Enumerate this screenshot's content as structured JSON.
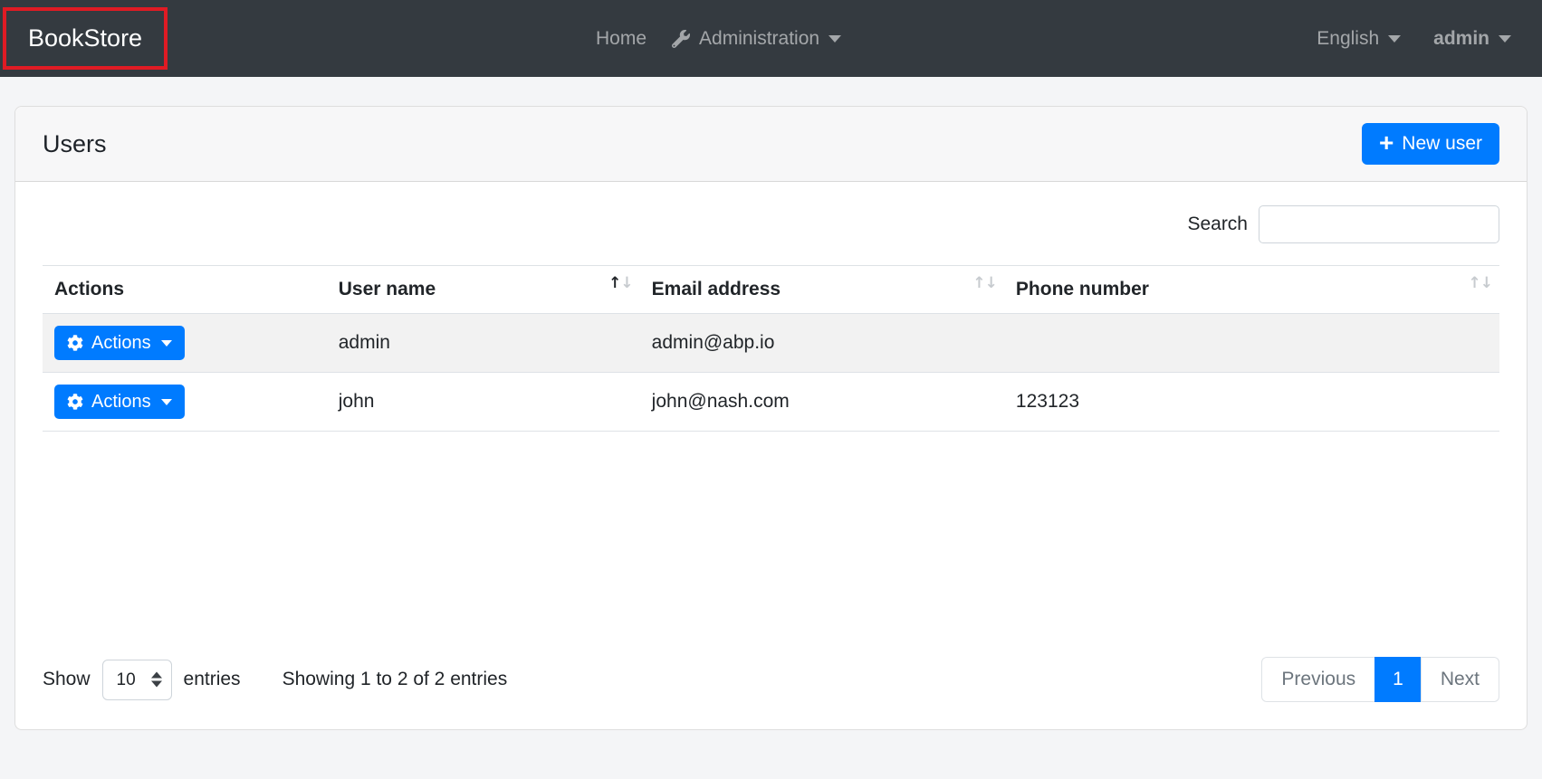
{
  "navbar": {
    "brand": "BookStore",
    "home": "Home",
    "administration": "Administration",
    "language": "English",
    "user": "admin"
  },
  "users_card": {
    "title": "Users",
    "new_user_button": "New user",
    "search_label": "Search",
    "search_value": ""
  },
  "users_table": {
    "headers": {
      "actions": "Actions",
      "user_name": "User name",
      "email": "Email address",
      "phone": "Phone number"
    },
    "sort_state": {
      "column": "User name",
      "direction": "ascending"
    },
    "rows": [
      {
        "actions": "Actions",
        "user_name": "admin",
        "email": "admin@abp.io",
        "phone": ""
      },
      {
        "actions": "Actions",
        "user_name": "john",
        "email": "john@nash.com",
        "phone": "123123"
      }
    ]
  },
  "table_footer": {
    "show_label": "Show",
    "page_size": "10",
    "entries_label": "entries",
    "info": "Showing 1 to 2 of 2 entries",
    "previous_label": "Previous",
    "current_page": "1",
    "next_label": "Next"
  },
  "icons": {
    "sort_asc": "↑",
    "sort_desc": "↓",
    "plus": "+"
  },
  "colors": {
    "primary": "#007bff",
    "navbar_bg": "#343a40",
    "annotation_red": "#e01b24",
    "stripe": "#f2f2f2"
  }
}
